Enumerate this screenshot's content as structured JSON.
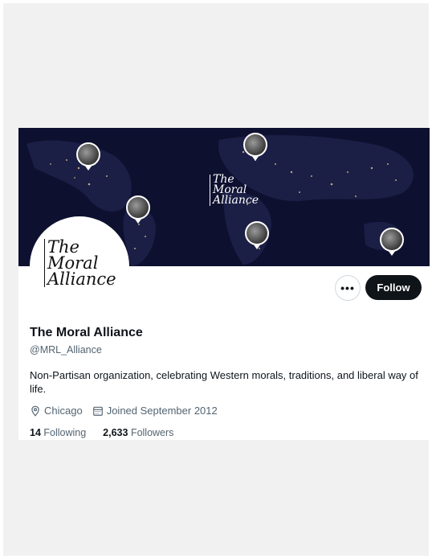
{
  "banner": {
    "logo_lines": [
      "The",
      "Moral",
      "Alliance"
    ]
  },
  "avatar": {
    "logo_lines": [
      "The",
      "Moral",
      "Alliance"
    ]
  },
  "actions": {
    "more_label": "•••",
    "follow_label": "Follow"
  },
  "profile": {
    "name": "The Moral Alliance",
    "handle": "@MRL_Alliance",
    "bio": "Non-Partisan organization, celebrating Western morals, traditions, and liberal way of life.",
    "location": "Chicago",
    "joined": "Joined September 2012",
    "following_count": "14",
    "following_label": "Following",
    "followers_count": "2,633",
    "followers_label": "Followers"
  },
  "icons": [
    "location-pin-icon",
    "calendar-icon",
    "more-options-icon"
  ],
  "colors": {
    "banner_bg": "#0e1030",
    "follow_btn": "#0f1419",
    "secondary_text": "#536471"
  }
}
